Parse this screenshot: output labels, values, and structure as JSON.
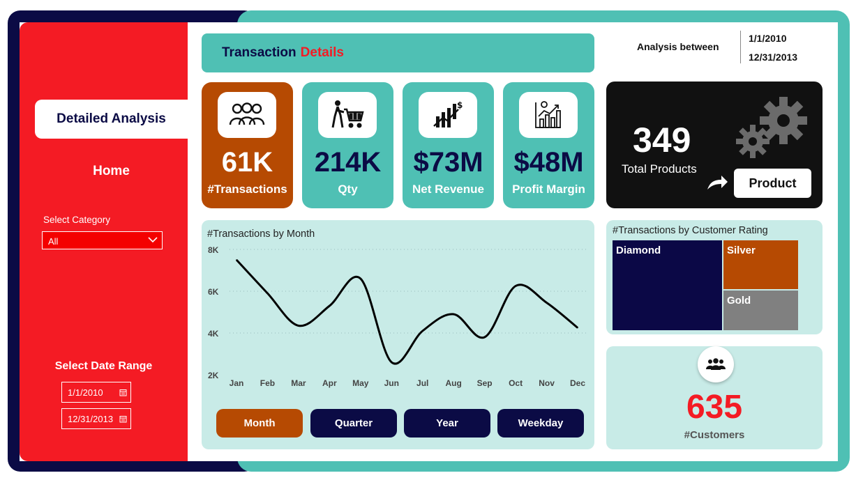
{
  "sidebar": {
    "nav_active": "Detailed Analysis",
    "nav_home": "Home",
    "category_label": "Select Category",
    "category_value": "All",
    "date_range_label": "Select Date Range",
    "date_start": "1/1/2010",
    "date_end": "12/31/2013"
  },
  "header": {
    "title_main": "Transaction",
    "title_accent": "Details",
    "analysis_label": "Analysis between",
    "analysis_start": "1/1/2010",
    "analysis_end": "12/31/2013"
  },
  "kpis": [
    {
      "value": "61K",
      "label": "#Transactions",
      "icon": "users-icon",
      "bg": "#b64a02"
    },
    {
      "value": "214K",
      "label": "Qty",
      "icon": "shopping-cart-icon",
      "bg": "#4fc0b4"
    },
    {
      "value": "$73M",
      "label": "Net Revenue",
      "icon": "revenue-chart-icon",
      "bg": "#4fc0b4"
    },
    {
      "value": "$48M",
      "label": "Profit Margin",
      "icon": "profit-chart-icon",
      "bg": "#4fc0b4"
    }
  ],
  "products": {
    "value": "349",
    "label": "Total Products",
    "button": "Product"
  },
  "chart_data": {
    "type": "line",
    "title": "#Transactions by Month",
    "categories": [
      "Jan",
      "Feb",
      "Mar",
      "Apr",
      "May",
      "Jun",
      "Jul",
      "Aug",
      "Sep",
      "Oct",
      "Nov",
      "Dec"
    ],
    "values": [
      7500,
      5900,
      4350,
      5300,
      6600,
      2600,
      4100,
      4900,
      3800,
      6250,
      5450,
      4250
    ],
    "y_ticks": [
      "8K",
      "6K",
      "4K",
      "2K"
    ],
    "ylim": [
      2000,
      8000
    ],
    "grid": true,
    "color": "#000000"
  },
  "time_buttons": [
    {
      "label": "Month",
      "active": true
    },
    {
      "label": "Quarter",
      "active": false
    },
    {
      "label": "Year",
      "active": false
    },
    {
      "label": "Weekday",
      "active": false
    }
  ],
  "rating": {
    "title": "#Transactions by Customer Rating",
    "tiles": [
      {
        "label": "Diamond",
        "color": "#0b0846"
      },
      {
        "label": "Silver",
        "color": "#b64a02"
      },
      {
        "label": "Gold",
        "color": "#808080"
      }
    ]
  },
  "customers": {
    "value": "635",
    "label": "#Customers",
    "icon": "customers-icon"
  },
  "colors": {
    "navy": "#0b0b45",
    "red": "#f41b24",
    "teal": "#4fc0b4",
    "orange": "#b64a02",
    "light_teal": "#c8ebe7"
  }
}
